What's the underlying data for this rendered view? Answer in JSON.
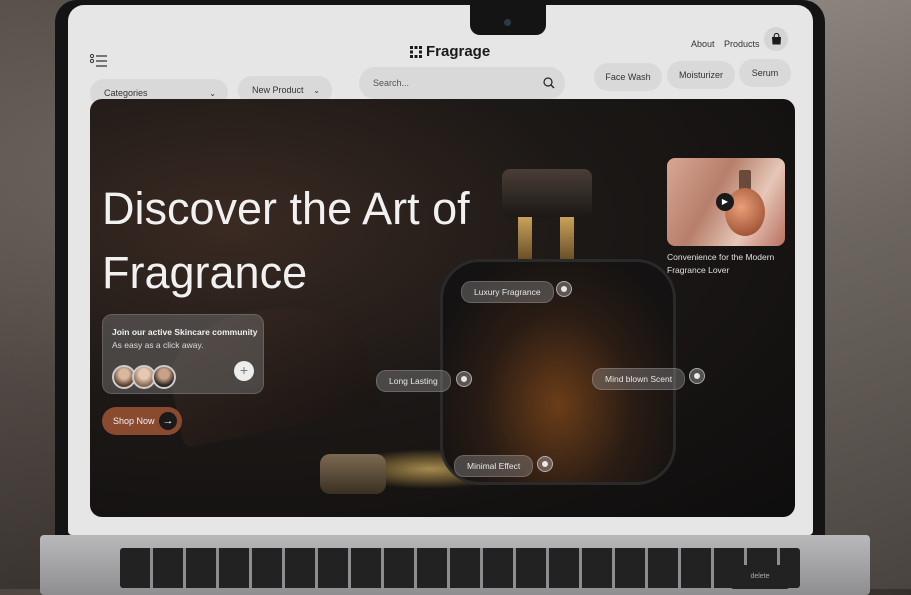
{
  "header": {
    "logo": "Fragrage",
    "nav": {
      "about": "About",
      "products": "Products"
    },
    "icons": {
      "menu": "menu-list-icon",
      "bag": "shopping-bag-icon",
      "search": "search-icon"
    }
  },
  "filters": {
    "categories": "Categories",
    "new_product": "New Product",
    "search_placeholder": "Search...",
    "chips": [
      "Face Wash",
      "Moisturizer",
      "Serum"
    ]
  },
  "hero": {
    "headline": "Discover the Art of Fragrance",
    "community": {
      "title": "Join our active Skincare community",
      "subtitle": "As easy as a click away."
    },
    "shop_now": "Shop Now",
    "tags": [
      "Luxury Fragrance",
      "Long Lasting",
      "Mind blown Scent",
      "Minimal Effect"
    ],
    "video_caption": "Convenience for the Modern Fragrance Lover"
  },
  "keyboard": {
    "delete_key": "delete"
  },
  "colors": {
    "accent": "#8a4a30",
    "hero_bg": "#141212",
    "ui_bg": "#e6e6e6"
  }
}
